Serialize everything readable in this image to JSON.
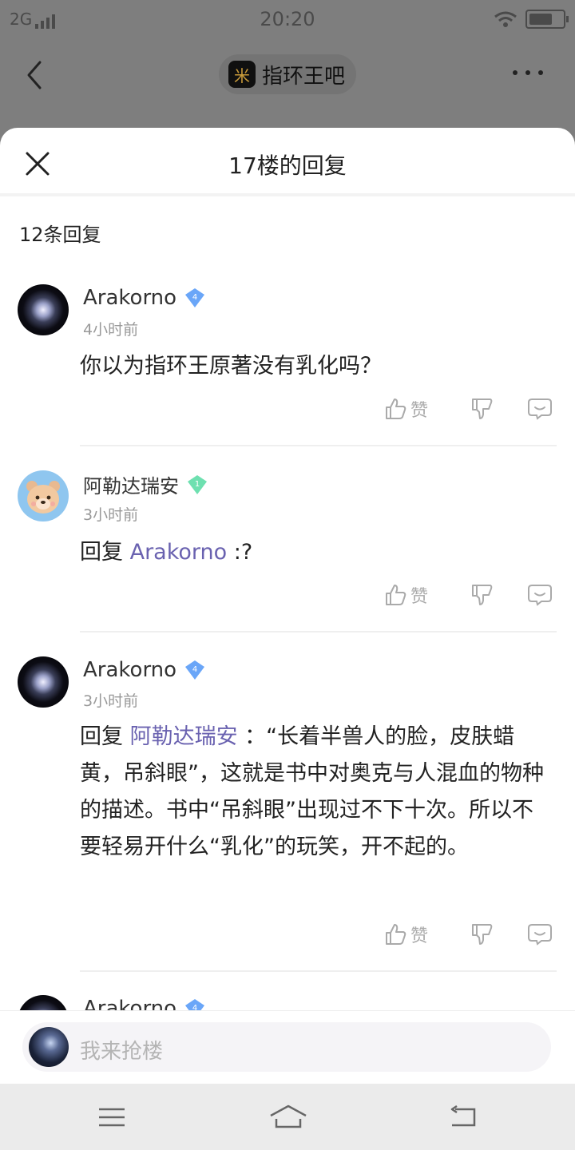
{
  "status": {
    "network": "2G",
    "time": "20:20"
  },
  "nav": {
    "forum_title": "指环王吧",
    "forum_logo_glyph": "米"
  },
  "sheet": {
    "title": "17楼的回复",
    "reply_count": "12条回复"
  },
  "comments": [
    {
      "username": "Arakorno",
      "level": "4",
      "time": "4小时前",
      "prefix": "",
      "mention": "",
      "text": "你以为指环王原著没有乳化吗？",
      "like_label": "赞"
    },
    {
      "username": "阿勒达瑞安",
      "level": "1",
      "time": "3小时前",
      "prefix": "回复 ",
      "mention": "Arakorno",
      "text": " :?",
      "like_label": "赞"
    },
    {
      "username": "Arakorno",
      "level": "4",
      "time": "3小时前",
      "prefix": "回复 ",
      "mention": "阿勒达瑞安",
      "text": " ：“长着半兽人的脸，皮肤蜡黄，吊斜眼”，这就是书中对奥克与人混血的物种的描述。书中“吊斜眼”出现过不下十次。所以不要轻易开什么“乳化”的玩笑，开不起的。",
      "like_label": "赞"
    },
    {
      "username": "Arakorno",
      "level": "4"
    }
  ],
  "input": {
    "placeholder": "我来抢楼"
  },
  "colors": {
    "mention": "#6a62b0",
    "badge_blue": "#6aa6f8",
    "badge_green": "#6ee0b0"
  }
}
